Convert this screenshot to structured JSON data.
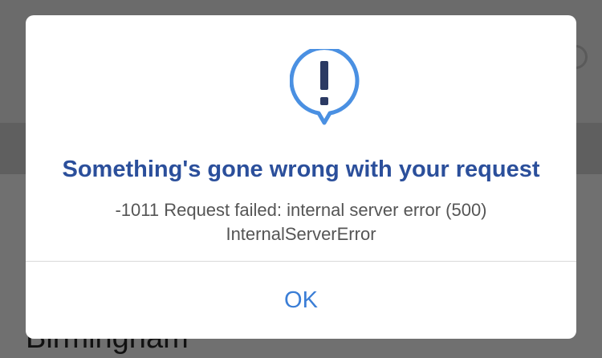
{
  "background": {
    "partial_text": "Birmingham"
  },
  "dialog": {
    "icon": "exclamation-speech-bubble-icon",
    "title": "Something's gone wrong with your request",
    "message_line1": "-1011 Request failed: internal server error (500)",
    "message_line2": "InternalServerError",
    "ok_label": "OK"
  },
  "colors": {
    "title": "#2b4f9b",
    "accent": "#3b7ed6",
    "icon": "#4a90e2",
    "message": "#555555",
    "overlay": "#707070"
  }
}
